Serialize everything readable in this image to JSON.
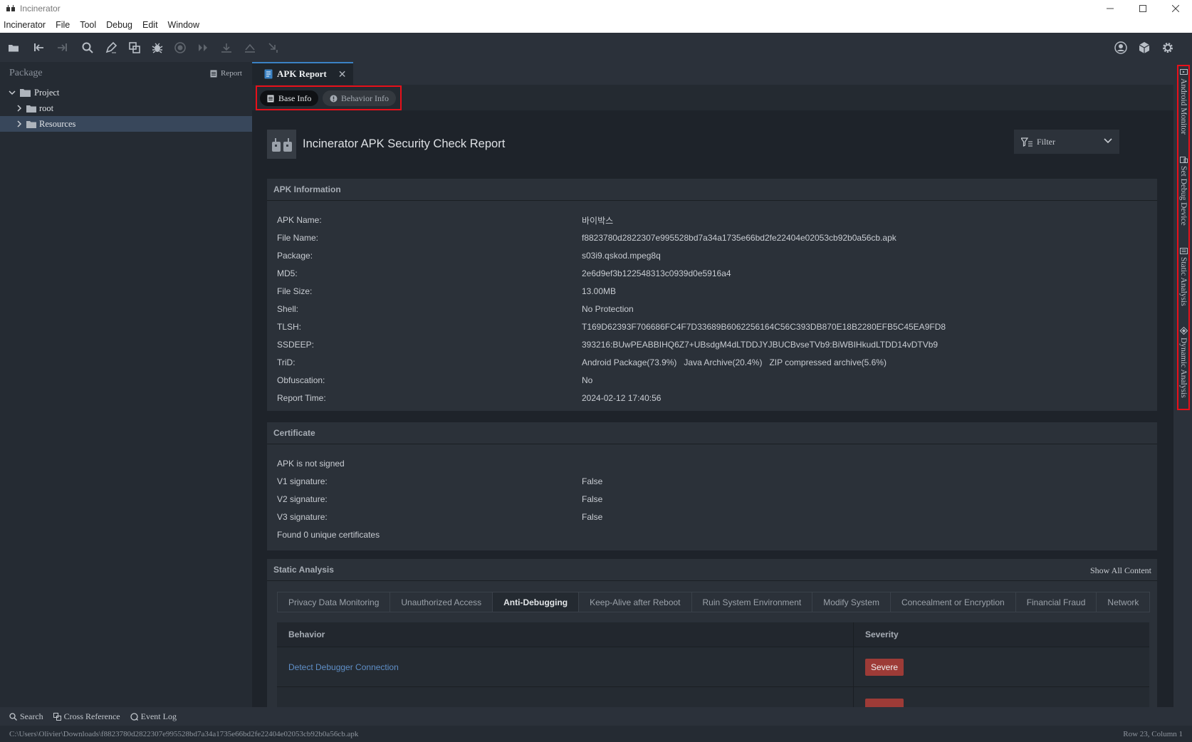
{
  "window": {
    "title": "Incinerator"
  },
  "menu": [
    "Incinerator",
    "File",
    "Tool",
    "Debug",
    "Edit",
    "Window"
  ],
  "sidebar": {
    "header": "Package",
    "report_button": "Report",
    "tree": [
      "Project",
      "root",
      "Resources"
    ]
  },
  "right_panel": {
    "tabs": [
      "Android Monitor",
      "Set Debug Device",
      "Static Analysis",
      "Dynamic Analysis"
    ]
  },
  "editor": {
    "tab": "APK Report",
    "subtabs": [
      "Base Info",
      "Behavior Info"
    ]
  },
  "report": {
    "title": "Incinerator APK Security Check Report",
    "filter_label": "Filter",
    "apk_info": {
      "title": "APK Information",
      "rows": [
        {
          "label": "APK Name:",
          "value": "바이박스"
        },
        {
          "label": "File Name:",
          "value": "f8823780d2822307e995528bd7a34a1735e66bd2fe22404e02053cb92b0a56cb.apk"
        },
        {
          "label": "Package:",
          "value": "s03i9.qskod.mpeg8q"
        },
        {
          "label": "MD5:",
          "value": "2e6d9ef3b122548313c0939d0e5916a4"
        },
        {
          "label": "File Size:",
          "value": "13.00MB"
        },
        {
          "label": "Shell:",
          "value": "No Protection"
        },
        {
          "label": "TLSH:",
          "value": "T169D62393F706686FC4F7D33689B6062256164C56C393DB870E18B2280EFB5C45EA9FD8"
        },
        {
          "label": "SSDEEP:",
          "value": "393216:BUwPEABBIHQ6Z7+UBsdgM4dLTDDJYJBUCBvseTVb9:BiWBIHkudLTDD14vDTVb9"
        },
        {
          "label": "TriD:",
          "value": "Android Package(73.9%)   Java Archive(20.4%)   ZIP compressed archive(5.6%)"
        },
        {
          "label": "Obfuscation:",
          "value": "No"
        },
        {
          "label": "Report Time:",
          "value": "2024-02-12 17:40:56"
        }
      ]
    },
    "certificate": {
      "title": "Certificate",
      "not_signed": "APK is not signed",
      "rows": [
        {
          "label": "V1 signature:",
          "value": "False"
        },
        {
          "label": "V2 signature:",
          "value": "False"
        },
        {
          "label": "V3 signature:",
          "value": "False"
        }
      ],
      "found": "Found 0 unique certificates"
    },
    "static_analysis": {
      "title": "Static Analysis",
      "show_all": "Show All Content",
      "categories": [
        "Privacy Data Monitoring",
        "Unauthorized Access",
        "Anti-Debugging",
        "Keep-Alive after Reboot",
        "Ruin System Environment",
        "Modify System",
        "Concealment or Encryption",
        "Financial Fraud",
        "Network"
      ],
      "active_category": "Anti-Debugging",
      "columns": [
        "Behavior",
        "Severity"
      ],
      "rows": [
        {
          "behavior": "Detect Debugger Connection",
          "severity": "Severe"
        }
      ]
    }
  },
  "bottom_tools": [
    "Search",
    "Cross Reference",
    "Event Log"
  ],
  "status": {
    "path": "C:\\Users\\Olivier\\Downloads\\f8823780d2822307e995528bd7a34a1735e66bd2fe22404e02053cb92b0a56cb.apk",
    "position": "Row 23, Column 1"
  },
  "colors": {
    "accent": "#3b82c4",
    "highlight": "#e8101a",
    "severe": "#9d3b37",
    "link": "#5f8fc7"
  }
}
